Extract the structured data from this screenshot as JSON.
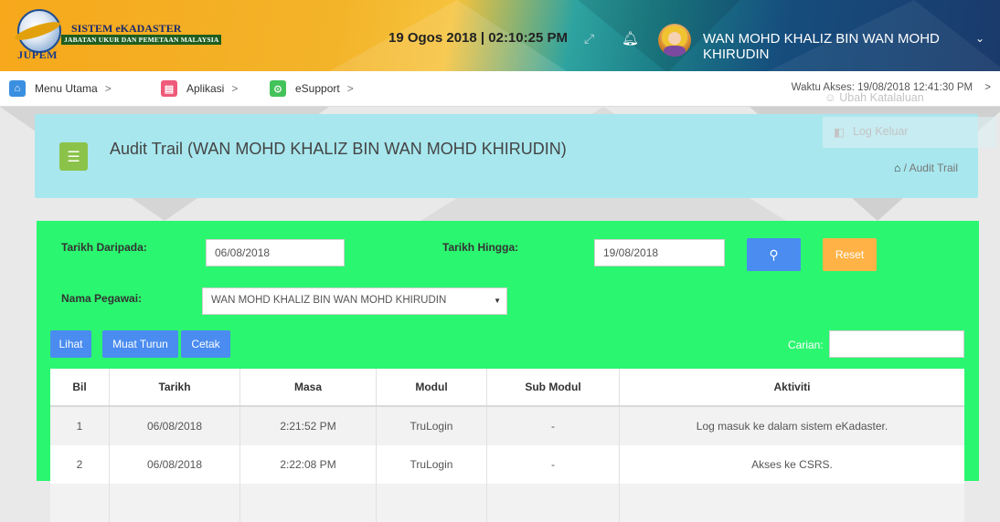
{
  "header": {
    "logo_text": "JUPEM",
    "brand_title": "SISTEM eKADASTER",
    "brand_subtitle": "JABATAN UKUR DAN PEMETAAN MALAYSIA",
    "datetime": "19 Ogos 2018 | 02:10:25 PM",
    "user_name": "WAN MOHD KHALIZ BIN WAN MOHD KHIRUDIN"
  },
  "nav": {
    "items": [
      {
        "label": "Menu Utama",
        "icon": "home-icon",
        "color": "#3b8fe0"
      },
      {
        "label": "Aplikasi",
        "icon": "monitor-icon",
        "color": "#ef5a7a"
      },
      {
        "label": "eSupport",
        "icon": "support-icon",
        "color": "#43c35a"
      }
    ],
    "waktu_akses": "Waktu Akses: 19/08/2018 12:41:30 PM",
    "user_menu": {
      "ubah": "Ubah Katalaluan",
      "logout": "Log Keluar"
    }
  },
  "page": {
    "title": "Audit Trail (WAN MOHD KHALIZ BIN WAN MOHD KHIRUDIN)",
    "breadcrumb": "/ Audit Trail"
  },
  "filter": {
    "tarikh_daripada_label": "Tarikh Daripada:",
    "tarikh_daripada_value": "06/08/2018",
    "tarikh_hingga_label": "Tarikh Hingga:",
    "tarikh_hingga_value": "19/08/2018",
    "nama_label": "Nama Pegawai:",
    "nama_value": "WAN MOHD KHALIZ BIN WAN MOHD KHIRUDIN",
    "reset_label": "Reset",
    "search_button_color": "#4a8cf0",
    "reset_button_color": "#ffb347"
  },
  "actions": {
    "lihat": "Lihat",
    "muat_turun": "Muat Turun",
    "cetak": "Cetak",
    "carian_label": "Carian:"
  },
  "table": {
    "headers": [
      "Bil",
      "Tarikh",
      "Masa",
      "Modul",
      "Sub Modul",
      "Aktiviti"
    ],
    "rows": [
      [
        "1",
        "06/08/2018",
        "2:21:52 PM",
        "TruLogin",
        "-",
        "Log masuk ke dalam sistem eKadaster."
      ],
      [
        "2",
        "06/08/2018",
        "2:22:08 PM",
        "TruLogin",
        "-",
        "Akses ke CSRS."
      ]
    ]
  },
  "colors": {
    "filter_panel_bg": "#2bf66f",
    "title_panel_bg": "#a8e7ee",
    "action_button_bg": "#4a8cf0"
  }
}
